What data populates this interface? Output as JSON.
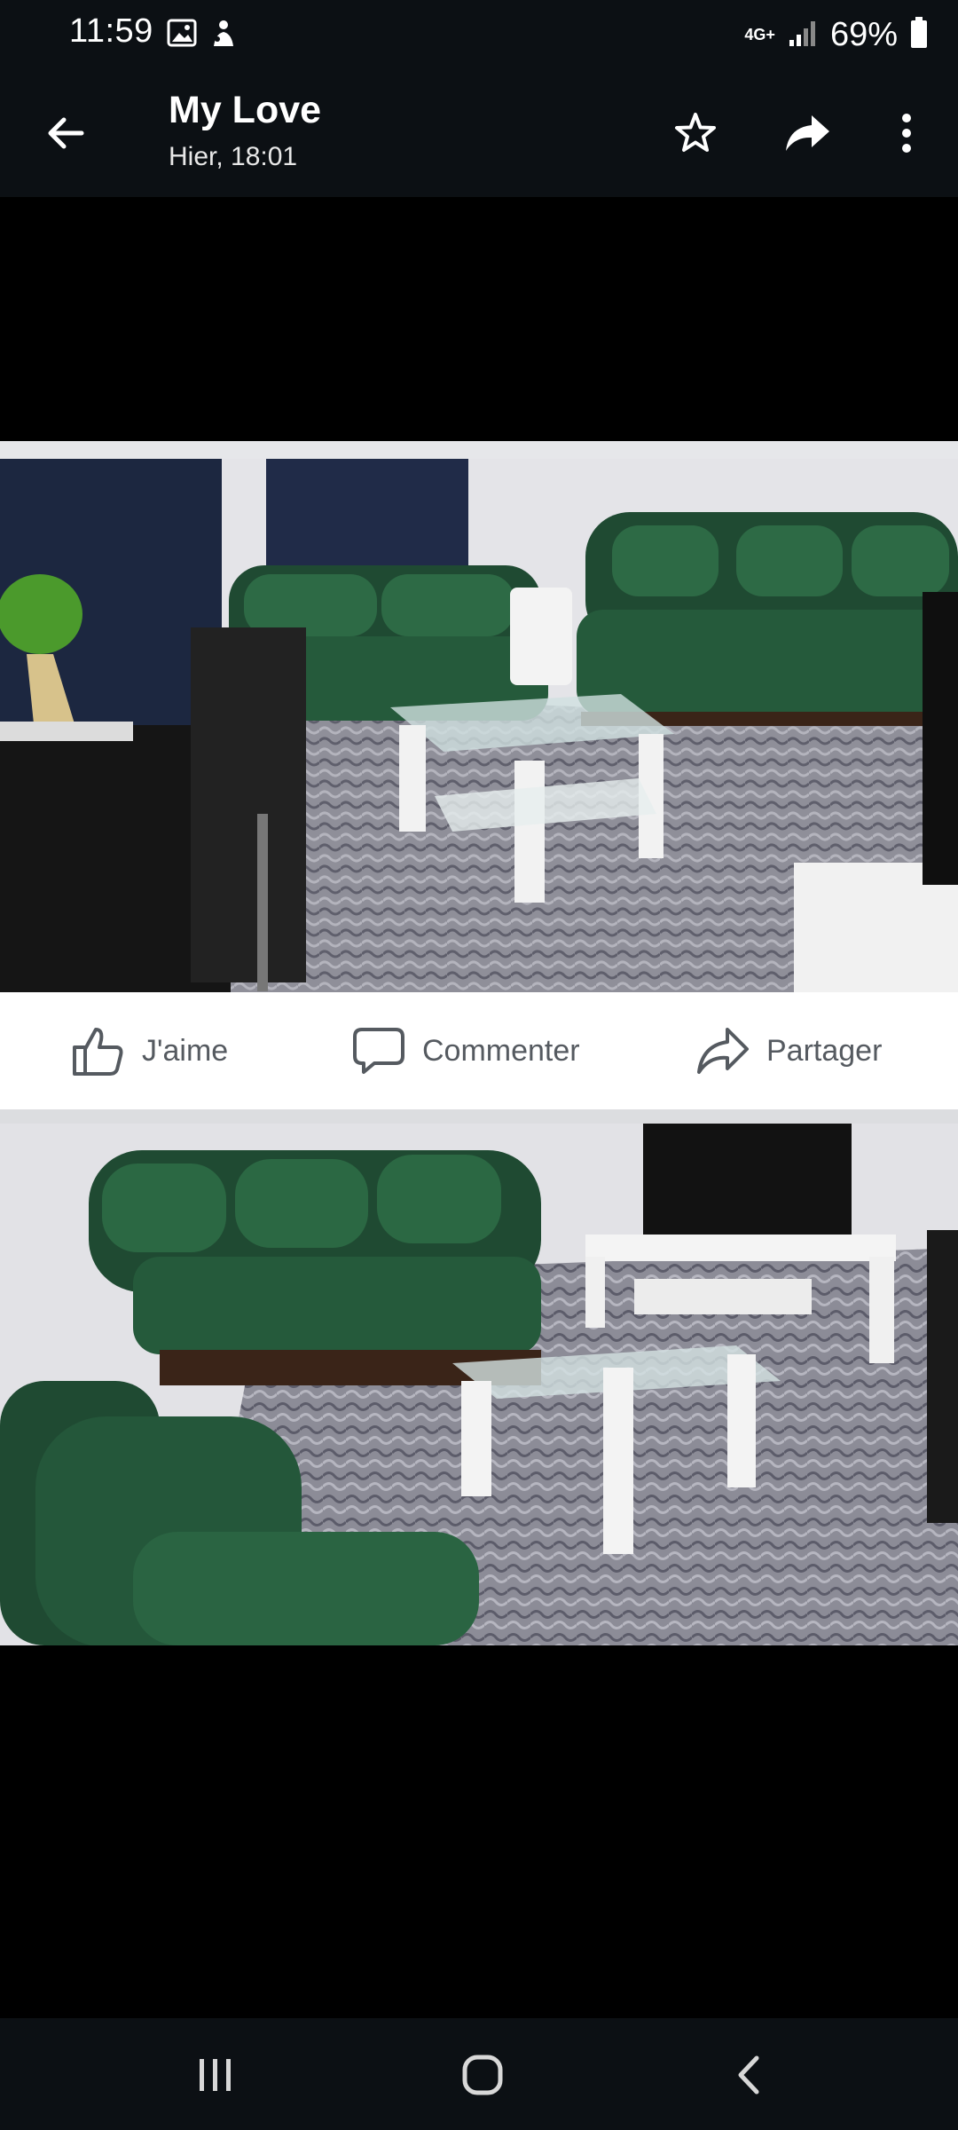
{
  "status_bar": {
    "time": "11:59",
    "network": "4G+",
    "battery": "69%"
  },
  "header": {
    "title": "My Love",
    "subtitle": "Hier, 18:01"
  },
  "post": {
    "actions": {
      "like": "J'aime",
      "comment": "Commenter",
      "share": "Partager"
    }
  },
  "colors": {
    "bar_bg": "#0c1014",
    "sofa_green": "#1f4a32",
    "action_text": "#555a60"
  }
}
